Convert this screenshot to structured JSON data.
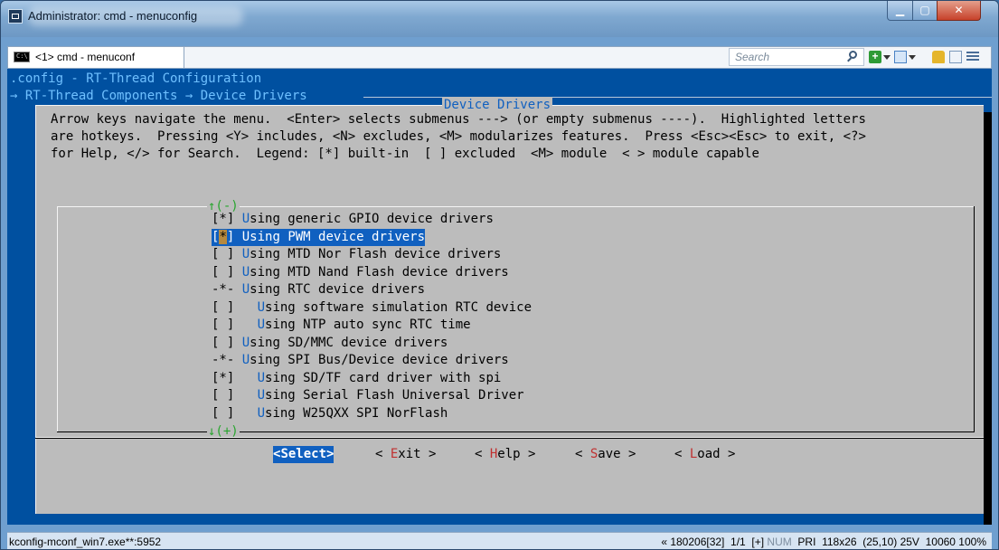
{
  "window": {
    "title": "Administrator: cmd - menuconfig"
  },
  "tab": {
    "label": "<1> cmd - menuconf"
  },
  "search": {
    "placeholder": "Search"
  },
  "console": {
    "title_line": ".config - RT-Thread Configuration",
    "breadcrumb": "→ RT-Thread Components → Device Drivers"
  },
  "dialog": {
    "title": "Device Drivers",
    "help": [
      "Arrow keys navigate the menu.  <Enter> selects submenus ---> (or empty submenus ----).  Highlighted letters",
      "are hotkeys.  Pressing <Y> includes, <N> excludes, <M> modularizes features.  Press <Esc><Esc> to exit, <?>",
      "for Help, </> for Search.  Legend: [*] built-in  [ ] excluded  <M> module  < > module capable"
    ],
    "scroll_up": "↑(-)",
    "scroll_down": "↓(+)",
    "items": [
      {
        "prefix": "[*] ",
        "hotkey": "U",
        "text": "sing generic GPIO device drivers"
      },
      {
        "prefix": "[*] ",
        "hotkey": "U",
        "text": "sing PWM device drivers",
        "selected": true
      },
      {
        "prefix": "[ ] ",
        "hotkey": "U",
        "text": "sing MTD Nor Flash device drivers"
      },
      {
        "prefix": "[ ] ",
        "hotkey": "U",
        "text": "sing MTD Nand Flash device drivers"
      },
      {
        "prefix": "-*- ",
        "hotkey": "U",
        "text": "sing RTC device drivers"
      },
      {
        "prefix": "[ ]   ",
        "hotkey": "U",
        "text": "sing software simulation RTC device"
      },
      {
        "prefix": "[ ]   ",
        "hotkey": "U",
        "text": "sing NTP auto sync RTC time"
      },
      {
        "prefix": "[ ] ",
        "hotkey": "U",
        "text": "sing SD/MMC device drivers"
      },
      {
        "prefix": "-*- ",
        "hotkey": "U",
        "text": "sing SPI Bus/Device device drivers"
      },
      {
        "prefix": "[*]   ",
        "hotkey": "U",
        "text": "sing SD/TF card driver with spi"
      },
      {
        "prefix": "[ ]   ",
        "hotkey": "U",
        "text": "sing Serial Flash Universal Driver"
      },
      {
        "prefix": "[ ]   ",
        "hotkey": "U",
        "text": "sing W25QXX SPI NorFlash"
      }
    ],
    "buttons": [
      {
        "name": "select",
        "pre": "<",
        "hotkey": "",
        "rest": "Select>",
        "active": true
      },
      {
        "name": "exit",
        "pre": "< ",
        "hotkey": "E",
        "rest": "xit >"
      },
      {
        "name": "help",
        "pre": "< ",
        "hotkey": "H",
        "rest": "elp >"
      },
      {
        "name": "save",
        "pre": "< ",
        "hotkey": "S",
        "rest": "ave >"
      },
      {
        "name": "load",
        "pre": "< ",
        "hotkey": "L",
        "rest": "oad >"
      }
    ]
  },
  "statusbar": {
    "left": "kconfig-mconf_win7.exe**:5952",
    "right_a": "« 180206[32]  1/1  [+] ",
    "right_num": "NUM",
    "right_b": "  PRI  118x26  (25,10) 25V  10060 100%"
  }
}
